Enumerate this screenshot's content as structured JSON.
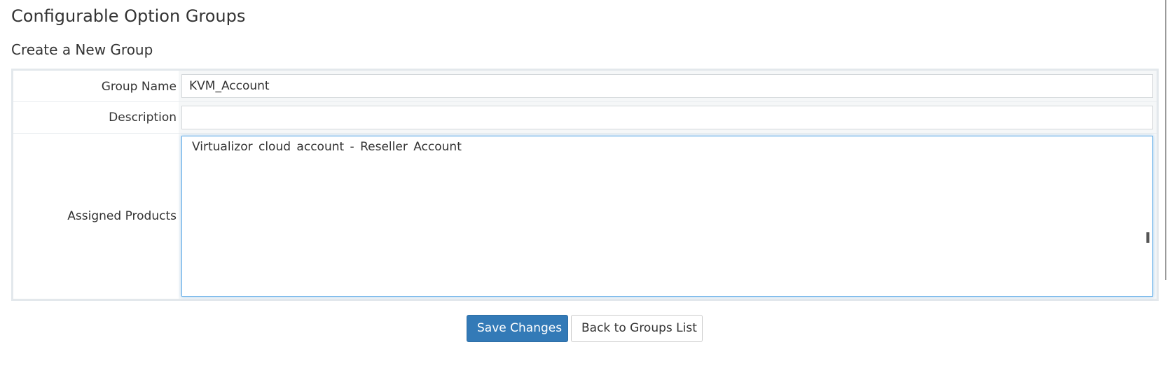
{
  "header": {
    "title": "Configurable Option Groups",
    "subtitle": "Create a New Group"
  },
  "form": {
    "group_name": {
      "label": "Group Name",
      "value": "KVM_Account"
    },
    "description": {
      "label": "Description",
      "value": ""
    },
    "assigned_products": {
      "label": "Assigned Products",
      "options": [
        "Virtualizor cloud account - Reseller Account"
      ]
    }
  },
  "actions": {
    "save_label": "Save Changes",
    "back_label": "Back to Groups List"
  },
  "colors": {
    "primary": "#337ab7",
    "focus_border": "#66afe9",
    "box_border": "#e3e8ec"
  }
}
